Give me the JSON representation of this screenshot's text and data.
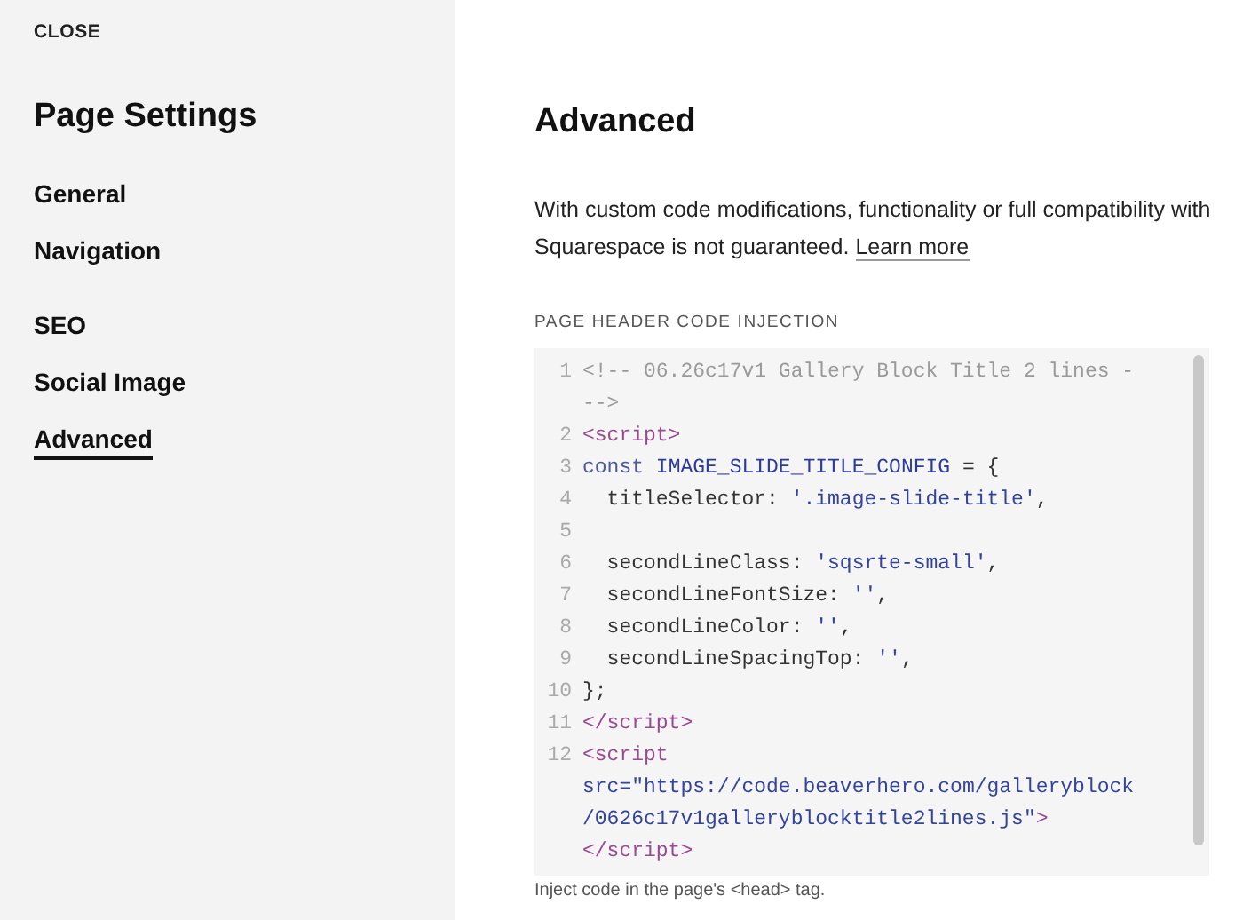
{
  "sidebar": {
    "close": "CLOSE",
    "title": "Page Settings",
    "groups": [
      {
        "items": [
          {
            "label": "General",
            "selected": false
          },
          {
            "label": "Navigation",
            "selected": false
          }
        ]
      },
      {
        "items": [
          {
            "label": "SEO",
            "selected": false
          },
          {
            "label": "Social Image",
            "selected": false
          },
          {
            "label": "Advanced",
            "selected": true
          }
        ]
      }
    ]
  },
  "main": {
    "title": "Advanced",
    "description": "With custom code modifications, functionality or full compatibility with Squarespace is not guaranteed.",
    "link": "Learn more",
    "field_label": "PAGE HEADER CODE INJECTION",
    "code_lines": [
      {
        "number": "1",
        "rows": [
          [
            {
              "kind": "comment",
              "text": "<!-- 06.26c17v1 Gallery Block Title 2 lines -"
            }
          ],
          [
            {
              "kind": "comment",
              "text": "-->"
            }
          ]
        ]
      },
      {
        "number": "2",
        "rows": [
          [
            {
              "kind": "tag",
              "text": "<script>"
            }
          ]
        ]
      },
      {
        "number": "3",
        "rows": [
          [
            {
              "kind": "keyword",
              "text": "const "
            },
            {
              "kind": "name",
              "text": "IMAGE_SLIDE_TITLE_CONFIG"
            },
            {
              "kind": "plain",
              "text": " = {"
            }
          ]
        ]
      },
      {
        "number": "4",
        "rows": [
          [
            {
              "kind": "plain",
              "text": "  titleSelector: "
            },
            {
              "kind": "string",
              "text": "'.image-slide-title'"
            },
            {
              "kind": "plain",
              "text": ","
            }
          ]
        ]
      },
      {
        "number": "5"
      },
      {
        "number": "6",
        "rows": [
          [
            {
              "kind": "plain",
              "text": "  secondLineClass: "
            },
            {
              "kind": "string",
              "text": "'sqsrte-small'"
            },
            {
              "kind": "plain",
              "text": ","
            }
          ]
        ]
      },
      {
        "number": "7",
        "rows": [
          [
            {
              "kind": "plain",
              "text": "  secondLineFontSize: "
            },
            {
              "kind": "string",
              "text": "''"
            },
            {
              "kind": "plain",
              "text": ","
            }
          ]
        ]
      },
      {
        "number": "8",
        "rows": [
          [
            {
              "kind": "plain",
              "text": "  secondLineColor: "
            },
            {
              "kind": "string",
              "text": "''"
            },
            {
              "kind": "plain",
              "text": ","
            }
          ]
        ]
      },
      {
        "number": "9",
        "rows": [
          [
            {
              "kind": "plain",
              "text": "  secondLineSpacingTop: "
            },
            {
              "kind": "string",
              "text": "''"
            },
            {
              "kind": "plain",
              "text": ","
            }
          ]
        ]
      },
      {
        "number": "10",
        "rows": [
          [
            {
              "kind": "plain",
              "text": "};"
            }
          ]
        ]
      },
      {
        "number": "11",
        "rows": [
          [
            {
              "kind": "tag",
              "text": "</script>"
            }
          ]
        ]
      },
      {
        "number": "12",
        "rows": [
          [
            {
              "kind": "tag",
              "text": "<script"
            }
          ],
          [
            {
              "kind": "attr",
              "text": "src="
            },
            {
              "kind": "string",
              "text": "\"https://code.beaverhero.com/galleryblock"
            }
          ],
          [
            {
              "kind": "string",
              "text": "/0626c17v1galleryblocktitle2lines.js\""
            },
            {
              "kind": "tag",
              "text": ">"
            }
          ],
          [
            {
              "kind": "tag",
              "text": "</script>"
            }
          ]
        ]
      }
    ],
    "hint": "Inject code in the page's <head> tag."
  }
}
